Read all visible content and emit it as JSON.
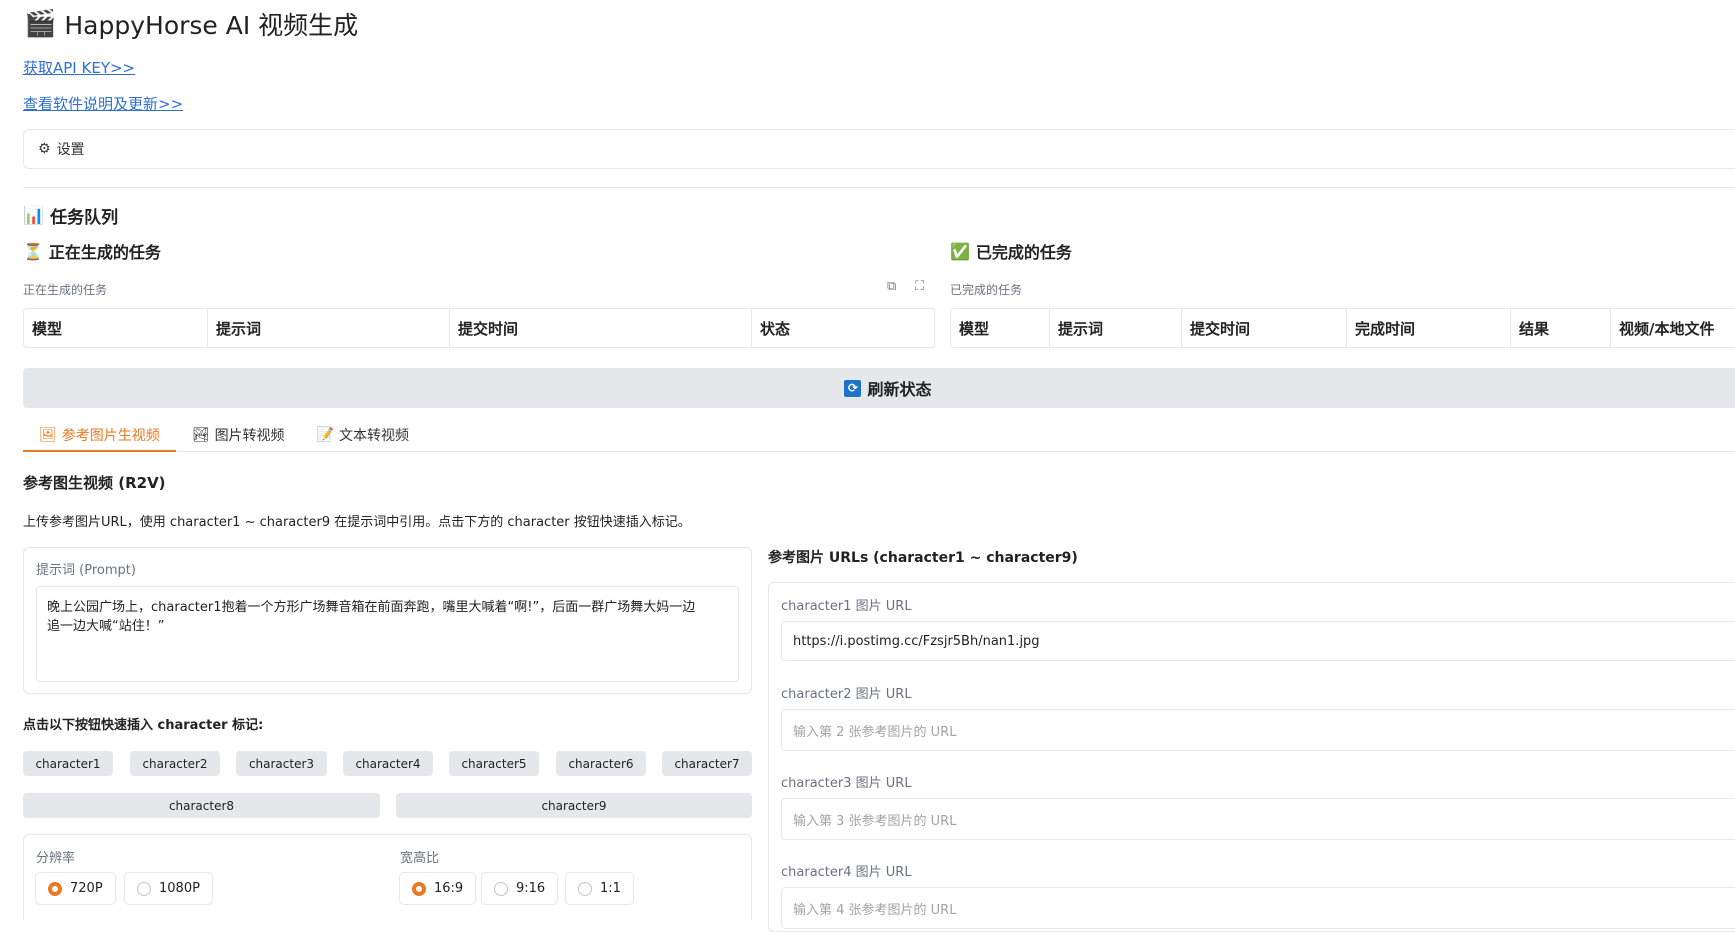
{
  "app": {
    "title": "HappyHorse AI 视频生成",
    "title_icon": "clapperboard-icon"
  },
  "links": {
    "api_key": "获取API KEY>>",
    "docs": "查看软件说明及更新>>"
  },
  "settings": {
    "label": "设置",
    "icon": "gear-icon"
  },
  "queue": {
    "title": "任务队列",
    "running": {
      "title": "正在生成的任务",
      "label": "正在生成的任务",
      "columns": [
        "模型",
        "提示词",
        "提交时间",
        "状态"
      ]
    },
    "done": {
      "title": "已完成的任务",
      "label": "已完成的任务",
      "columns": [
        "模型",
        "提示词",
        "提交时间",
        "完成时间",
        "结果",
        "视频/本地文件"
      ]
    }
  },
  "refresh": {
    "label": "刷新状态"
  },
  "tabs": [
    {
      "label": "参考图片生视频",
      "icon": "picture-icon",
      "active": true
    },
    {
      "label": "图片转视频",
      "icon": "image-mountain-icon",
      "active": false
    },
    {
      "label": "文本转视频",
      "icon": "memo-icon",
      "active": false
    }
  ],
  "r2v": {
    "heading": "参考图生视频 (R2V)",
    "description": "上传参考图片URL，使用 character1 ~ character9 在提示词中引用。点击下方的 character 按钮快速插入标记。",
    "prompt_label": "提示词 (Prompt)",
    "prompt_line1": "晚上公园广场上，character1抱着一个方形广场舞音箱在前面奔跑，嘴里大喊着“啊!”，后面一群广场舞大妈一边",
    "prompt_line2": "追一边大喊“站住！”",
    "insert_label": "点击以下按钮快速插入 character 标记:",
    "chips_row1": [
      "character1",
      "character2",
      "character3",
      "character4",
      "character5",
      "character6",
      "character7"
    ],
    "chips_row2": [
      "character8",
      "character9"
    ],
    "resolution": {
      "label": "分辨率",
      "options": [
        "720P",
        "1080P"
      ],
      "selected": "720P"
    },
    "aspect": {
      "label": "宽高比",
      "options": [
        "16:9",
        "9:16",
        "1:1"
      ],
      "selected": "16:9"
    },
    "urls_heading": "参考图片 URLs (character1 ~ character9)",
    "urls": [
      {
        "label": "character1 图片 URL",
        "value": "https://i.postimg.cc/Fzsjr5Bh/nan1.jpg",
        "placeholder": ""
      },
      {
        "label": "character2 图片 URL",
        "value": "",
        "placeholder": "输入第 2 张参考图片的 URL"
      },
      {
        "label": "character3 图片 URL",
        "value": "",
        "placeholder": "输入第 3 张参考图片的 URL"
      },
      {
        "label": "character4 图片 URL",
        "value": "",
        "placeholder": "输入第 4 张参考图片的 URL"
      }
    ]
  }
}
